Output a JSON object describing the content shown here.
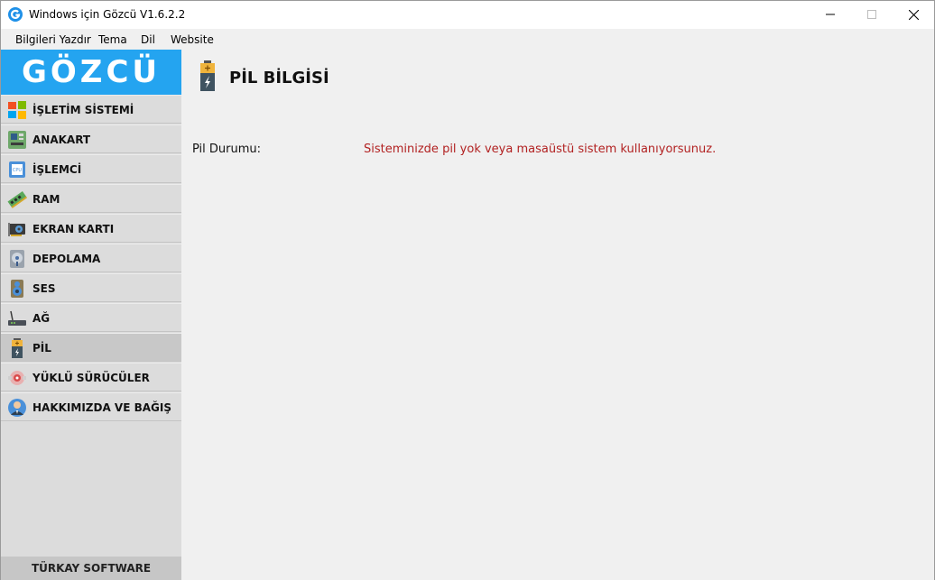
{
  "window": {
    "title": "Windows için Gözcü V1.6.2.2",
    "app_icon": "g-logo-icon",
    "controls": [
      "minimize-icon",
      "maximize-icon",
      "close-icon"
    ]
  },
  "menu": {
    "items": [
      {
        "label": "Bilgileri Yazdır"
      },
      {
        "label": "Tema"
      },
      {
        "label": "Dil"
      },
      {
        "label": "Website"
      }
    ]
  },
  "sidebar": {
    "logo": "GÖZCÜ",
    "items": [
      {
        "label": "İŞLETİM SİSTEMİ",
        "icon": "windows-logo-icon"
      },
      {
        "label": "ANAKART",
        "icon": "motherboard-icon"
      },
      {
        "label": "İŞLEMCİ",
        "icon": "cpu-icon"
      },
      {
        "label": "RAM",
        "icon": "ram-icon"
      },
      {
        "label": "EKRAN KARTI",
        "icon": "graphics-card-icon"
      },
      {
        "label": "DEPOLAMA",
        "icon": "hard-drive-icon"
      },
      {
        "label": "SES",
        "icon": "speaker-icon"
      },
      {
        "label": "AĞ",
        "icon": "router-icon"
      },
      {
        "label": "PİL",
        "icon": "battery-icon",
        "active": true
      },
      {
        "label": "YÜKLÜ SÜRÜCÜLER",
        "icon": "drivers-icon"
      },
      {
        "label": "HAKKIMIZDA VE BAĞIŞ",
        "icon": "user-icon"
      }
    ],
    "footer": "TÜRKAY SOFTWARE"
  },
  "main": {
    "title": "PİL BİLGİSİ",
    "icon": "battery-icon",
    "fields": [
      {
        "label": "Pil Durumu:",
        "value": "Sisteminizde pil yok veya masaüstü sistem kullanıyorsunuz."
      }
    ]
  },
  "colors": {
    "accent": "#24a4f0",
    "error_text": "#b22222",
    "sidebar_bg": "#dcdcdc",
    "active_item_bg": "#c8c8c8"
  }
}
